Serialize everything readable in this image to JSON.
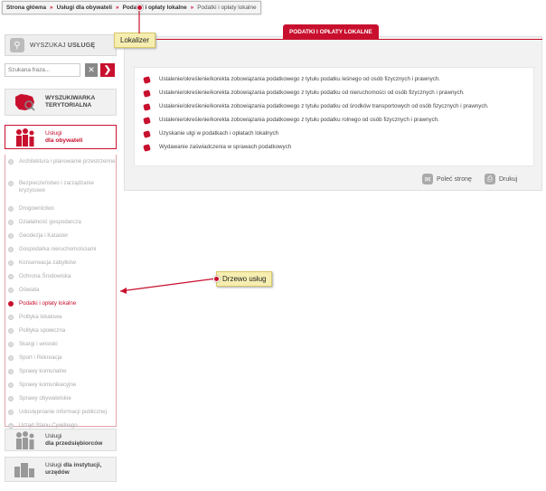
{
  "breadcrumb": {
    "home": "Strona główna",
    "level1": "Usługi dla obywateli",
    "level2": "Podatki i opłaty lokalne",
    "current": "Podatki i opłaty lokalne",
    "separator": "»"
  },
  "callouts": {
    "locator": "Lokalizer",
    "tree": "Drzewo usług"
  },
  "search": {
    "title_light": "WYSZUKAJ",
    "title_bold": "USŁUGĘ",
    "placeholder": "Szukana fraza...",
    "clear_icon": "close-icon",
    "go_icon": "chevron-right-icon"
  },
  "tiles": {
    "territorial": {
      "line1": "WYSZUKIWARKA",
      "line2": "TERYTORIALNA"
    },
    "citizens": {
      "line1": "Usługi",
      "line2": "dla obywateli"
    },
    "business": {
      "line1": "Usługi",
      "line2": "dla przedsiębiorców"
    },
    "institutions": {
      "line1_light": "Usługi",
      "line1_bold": "dla instytucji,",
      "line2": "urzędów"
    }
  },
  "tree": {
    "items": [
      "Architektura i planowanie przestrzenne",
      "Bezpieczeństwo i zarządzanie kryzysowe",
      "Drogownictwo",
      "Działalność gospodarcza",
      "Geodezja i Kataster",
      "Gospodarka nieruchomościami",
      "Konserwacja zabytków",
      "Ochrona Środowiska",
      "Oświata",
      "Podatki i opłaty lokalne",
      "Polityka lokalowa",
      "Polityka społeczna",
      "Skargi i wnioski",
      "Sport i Rekreacja",
      "Sprawy komunalne",
      "Sprawy komunikacyjne",
      "Sprawy obywatelskie",
      "Udostępnianie informacji publicznej",
      "Urząd Stanu Cywilnego"
    ],
    "active_item": "Podatki i opłaty lokalne"
  },
  "main": {
    "tab_label": "PODATKI I OPŁATY LOKALNE",
    "items": [
      "Ustalenie/określenie/korekta zobowiązania podatkowego z tytułu podatku leśnego od osób fizycznych i prawnych.",
      "Ustalenie/określenie/korekta zobowiązania podatkowego z tytułu podatku od nieruchomości od osób fizycznych i prawnych.",
      "Ustalenie/określenie/korekta zobowiązania podatkowego z tytułu podatku od środków transportowych od osób fizycznych i prawnych.",
      "Ustalenie/określenie/korekta zobowiązania podatkowego z tytułu podatku rolnego od osób fizycznych i prawnych.",
      "Uzyskanie ulgi w podatkach i opłatach lokalnych",
      "Wydawanie zaświadczenia w sprawach podatkowych"
    ],
    "recommend_label": "Poleć stronę",
    "print_label": "Drukuj"
  },
  "colors": {
    "accent": "#c8102e",
    "callout_bg": "#f6eeb0",
    "panel_bg": "#f2f2f2"
  }
}
